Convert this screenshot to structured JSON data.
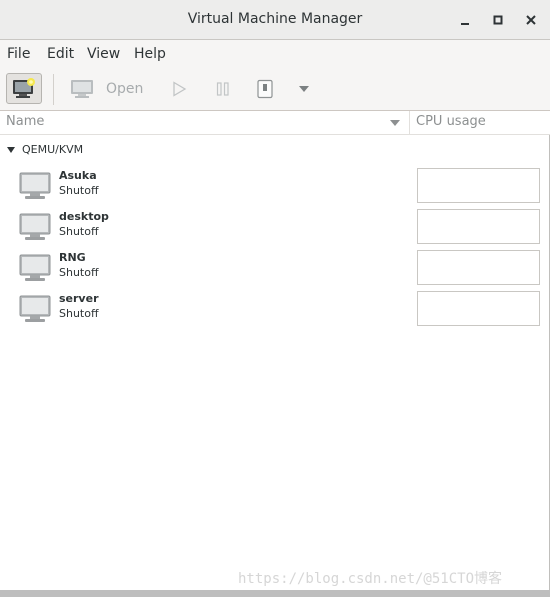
{
  "window": {
    "title": "Virtual Machine Manager"
  },
  "menu": [
    "File",
    "Edit",
    "View",
    "Help"
  ],
  "toolbar": {
    "open_label": "Open"
  },
  "columns": {
    "name": "Name",
    "cpu": "CPU usage"
  },
  "group": {
    "label": "QEMU/KVM"
  },
  "vms": [
    {
      "name": "Asuka",
      "state": "Shutoff"
    },
    {
      "name": "desktop",
      "state": "Shutoff"
    },
    {
      "name": "RNG",
      "state": "Shutoff"
    },
    {
      "name": "server",
      "state": "Shutoff"
    }
  ],
  "watermark": "https://blog.csdn.net/@51CTO博客",
  "colors": {
    "titlebar": "#ededec",
    "toolbar": "#f6f5f4",
    "icon_disabled": "#b9bdbf"
  }
}
